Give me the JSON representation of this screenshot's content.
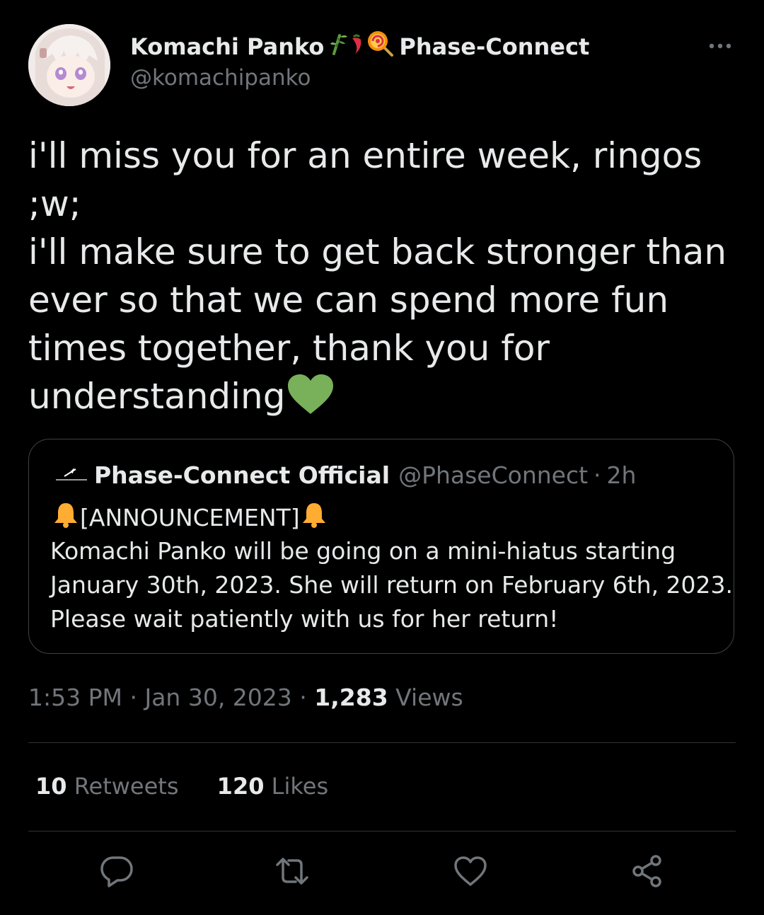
{
  "author": {
    "name": "Komachi Panko",
    "affiliation": "Phase-Connect",
    "handle": "@komachipanko",
    "name_emojis": [
      "bamboo-icon",
      "chili-pepper-icon",
      "lollipop-icon"
    ]
  },
  "tweet": {
    "lines": [
      "i'll miss you for an entire week, ringos",
      ";w;",
      "i'll make sure to get back stronger than",
      "ever so that we can spend more fun",
      "times together, thank you for",
      "understanding"
    ],
    "trailing_emoji": "green-heart-icon",
    "heart_color": "#78b159"
  },
  "quoted": {
    "name": "Phase-Connect Official",
    "handle": "@PhaseConnect",
    "separator": "·",
    "time": "2h",
    "announcement": "[ANNOUNCEMENT]",
    "bell_color": "#ffac33",
    "body_lines": [
      "Komachi Panko will be going on a mini-hiatus starting",
      "January 30th, 2023. She will return on February 6th, 2023.",
      "Please wait patiently with us for her return!"
    ]
  },
  "meta": {
    "time": "1:53 PM",
    "sep1": "·",
    "date": "Jan 30, 2023",
    "sep2": "·",
    "views_count": "1,283",
    "views_label": "Views"
  },
  "stats": {
    "retweets_count": "10",
    "retweets_label": "Retweets",
    "likes_count": "120",
    "likes_label": "Likes"
  },
  "actions": [
    "reply-icon",
    "retweet-icon",
    "like-icon",
    "share-icon"
  ],
  "colors": {
    "background": "#000000",
    "text": "#e7e9ea",
    "secondary": "#71767b",
    "border": "#2f3336"
  }
}
